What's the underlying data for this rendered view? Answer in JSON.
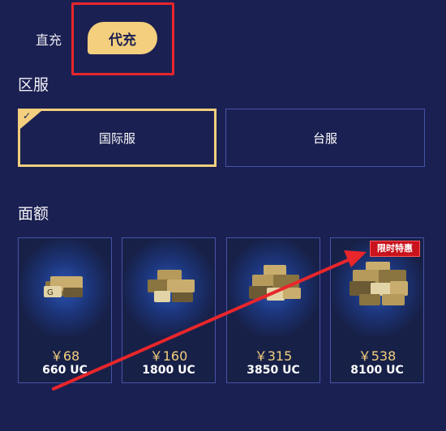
{
  "tabs": {
    "direct_label": "直充",
    "proxy_label": "代充"
  },
  "region": {
    "title": "区服",
    "servers": [
      {
        "label": "国际服",
        "selected": true
      },
      {
        "label": "台服",
        "selected": false
      }
    ]
  },
  "denomination": {
    "title": "面额",
    "items": [
      {
        "price": "￥68",
        "uc": "660 UC"
      },
      {
        "price": "￥160",
        "uc": "1800 UC"
      },
      {
        "price": "￥315",
        "uc": "3850 UC"
      },
      {
        "price": "￥538",
        "uc": "8100 UC",
        "badge": "限时特惠"
      }
    ]
  },
  "colors": {
    "background": "#1b2052",
    "accent": "#f3cf7e",
    "annotation": "#e8262b"
  },
  "icons": {
    "check": "check-icon",
    "uc_pack": "uc-coin-pack-icon"
  }
}
